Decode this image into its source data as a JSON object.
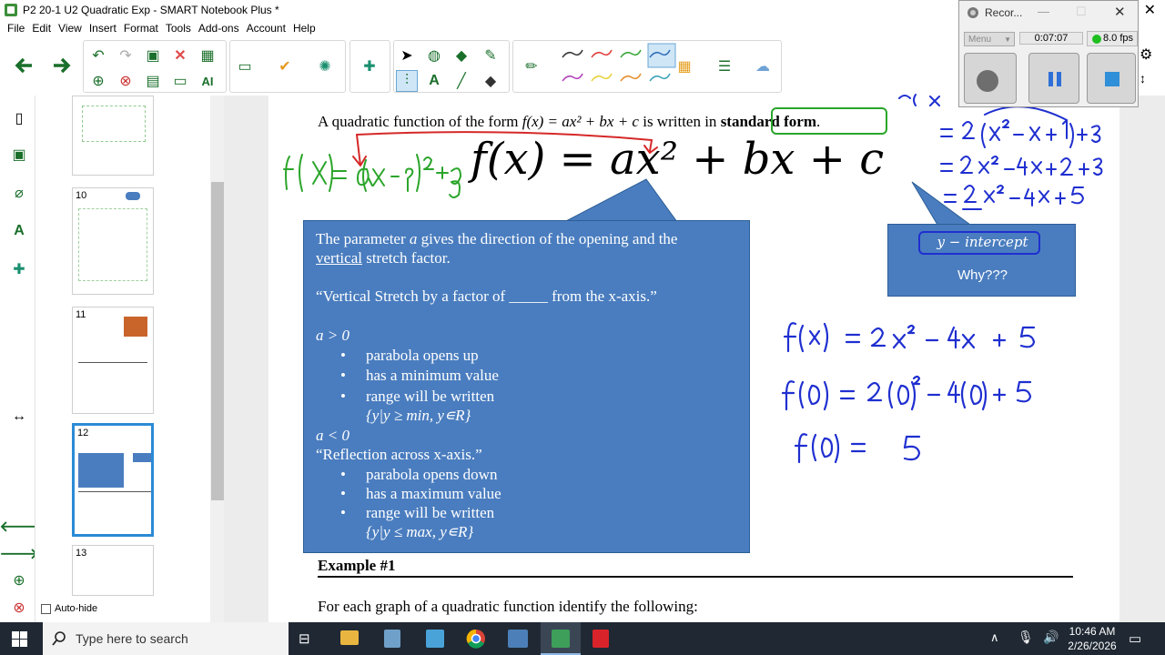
{
  "window": {
    "title": "P2 20-1 U2 Quadratic Exp - SMART Notebook Plus *",
    "close_glyph": "✕"
  },
  "menu": [
    "File",
    "Edit",
    "View",
    "Insert",
    "Format",
    "Tools",
    "Add-ons",
    "Account",
    "Help"
  ],
  "toolbar": {
    "text_tool_label": "A",
    "pen_colors": [
      "#333333",
      "#e23b3b",
      "#37a637",
      "#2f6fb8",
      "#b03fb8",
      "#e6d23a",
      "#e58d2a",
      "#3aa3b8"
    ]
  },
  "sorter": {
    "pages": [
      {
        "num": ""
      },
      {
        "num": "10"
      },
      {
        "num": "11"
      },
      {
        "num": "12",
        "selected": true
      },
      {
        "num": "13"
      }
    ],
    "autohide_label": "Auto-hide"
  },
  "page": {
    "intro_prefix": "A quadratic function of the form ",
    "intro_func": "f(x) = ax² + bx + c",
    "intro_suffix": " is written in ",
    "intro_bold": "standard form",
    "intro_end": ".",
    "big_formula": "f(x) = ax² + bx + c",
    "callout": {
      "line1a": "The parameter ",
      "line1b": "a",
      "line1c": " gives the direction of the opening and the",
      "line2a": "vertical",
      "line2b": " stretch factor.",
      "line3": "“Vertical Stretch by a factor of _____ from the x-axis.”",
      "apos_head": "a > 0",
      "apos_items": [
        "parabola opens up",
        "has a minimum value",
        "range will be written"
      ],
      "apos_range": "{y|y ≥ min, y∊R}",
      "aneg_head": "a < 0",
      "aneg_reflect": "“Reflection across x-axis.”",
      "aneg_items": [
        "parabola opens down",
        "has a maximum value",
        "range will be written"
      ],
      "aneg_range": "{y|y ≤ max, y∊R}"
    },
    "y_callout": {
      "title": "y − intercept",
      "subtitle": "Why???"
    },
    "example_heading": "Example #1",
    "example_text": "For each graph of a quadratic function identify the following:"
  },
  "recorder": {
    "title": "Recor...",
    "menu_label": "Menu",
    "elapsed": "0:07:07",
    "fps": "8.0 fps"
  },
  "taskbar": {
    "search_placeholder": "Type here to search",
    "time": "10:46 AM",
    "date": "2/26/2026"
  },
  "colors": {
    "callout_blue": "#4a7dbf",
    "ink_green": "#2aa52a",
    "ink_red": "#d62828",
    "ink_blue": "#1f2fd0",
    "thumb_selected": "#2b8bd6"
  }
}
